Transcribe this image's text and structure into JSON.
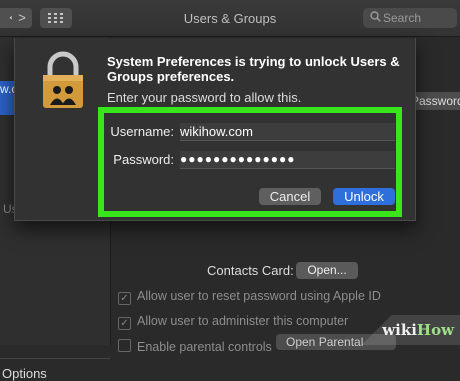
{
  "window": {
    "title": "Users & Groups"
  },
  "toolbar": {
    "back_label": "<",
    "forward_label": ">",
    "grid_icon": "grid-icon"
  },
  "search": {
    "placeholder": "Search",
    "icon": "search-icon"
  },
  "sidebar": {
    "selected_text": "w.co",
    "partial_label": "Us",
    "options_label": "Options"
  },
  "main": {
    "password_button": "Password...",
    "contacts_card_label": "Contacts Card:",
    "open_button": "Open...",
    "checkboxes": [
      {
        "label": "Allow user to reset password using Apple ID",
        "checked": true
      },
      {
        "label": "Allow user to administer this computer",
        "checked": true
      },
      {
        "label": "Enable parental controls",
        "checked": false
      }
    ],
    "parental_button": "Open Parental Controls..."
  },
  "dialog": {
    "title": "System Preferences is trying to unlock Users & Groups preferences.",
    "subtitle": "Enter your password to allow this.",
    "username_label": "Username:",
    "username_value": "wikihow.com",
    "password_label": "Password:",
    "password_value": "●●●●●●●●●●●●●●",
    "cancel_label": "Cancel",
    "unlock_label": "Unlock",
    "icon": "lock-users-icon"
  },
  "annotation": {
    "highlight_color": "#39e61c"
  },
  "watermark": {
    "wiki": "wiki",
    "how": "How"
  }
}
